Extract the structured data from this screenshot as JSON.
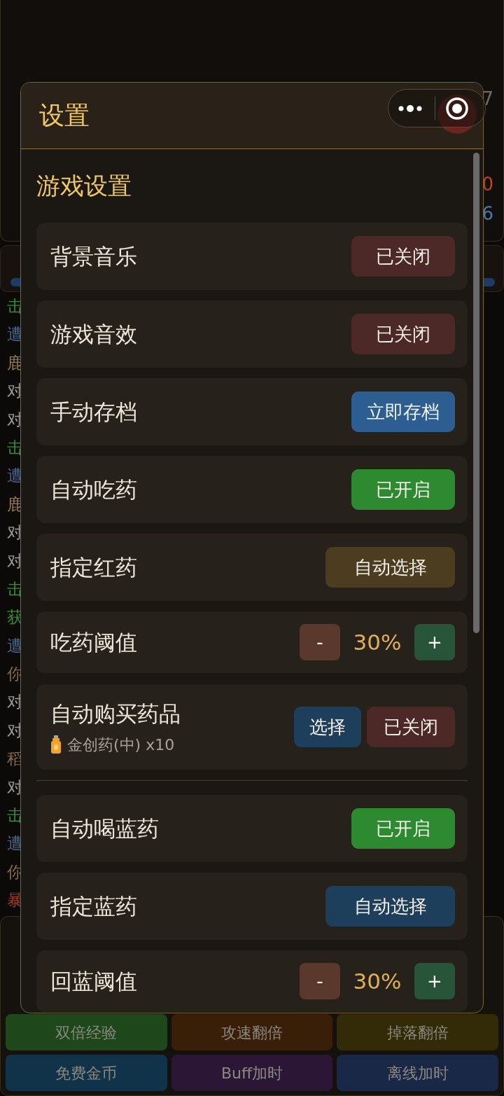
{
  "background": {
    "corner_mark": "7",
    "stats": [
      {
        "value": "0",
        "color": "#b8452e"
      },
      {
        "value": "6",
        "color": "#4a78b8"
      }
    ],
    "log": [
      {
        "text": "击",
        "color": "#3e8a3a"
      },
      {
        "text": "遭",
        "color": "#4a6890"
      },
      {
        "text": "鹿",
        "color": "#9a7a4a"
      },
      {
        "text": "对",
        "color": "#9a9a9a"
      },
      {
        "text": "对",
        "color": "#9a9a9a"
      },
      {
        "text": "击",
        "color": "#3e8a3a"
      },
      {
        "text": "遭",
        "color": "#4a6890"
      },
      {
        "text": "鹿",
        "color": "#9a7a4a"
      },
      {
        "text": "对",
        "color": "#9a9a9a"
      },
      {
        "text": "对",
        "color": "#9a9a9a"
      },
      {
        "text": "击",
        "color": "#3e8a3a"
      },
      {
        "text": "获",
        "color": "#3e8a3a"
      },
      {
        "text": "遭",
        "color": "#4a6890"
      },
      {
        "text": "你",
        "color": "#8a6a40"
      },
      {
        "text": "对",
        "color": "#9a9a9a"
      },
      {
        "text": "对",
        "color": "#9a9a9a"
      },
      {
        "text": "稻",
        "color": "#8a6a40"
      },
      {
        "text": "对",
        "color": "#9a9a9a"
      },
      {
        "text": "击",
        "color": "#3e8a3a"
      },
      {
        "text": "遭",
        "color": "#4a6890"
      },
      {
        "text": "你",
        "color": "#8a6a40"
      },
      {
        "text": "暴",
        "color": "#a83a28"
      }
    ],
    "boost_buttons": [
      {
        "label": "双倍经验",
        "color": "#1e481c"
      },
      {
        "label": "攻速翻倍",
        "color": "#3a1f08"
      },
      {
        "label": "掉落翻倍",
        "color": "#332a08"
      },
      {
        "label": "免费金币",
        "color": "#11334a"
      },
      {
        "label": "Buff加时",
        "color": "#2c1636"
      },
      {
        "label": "离线加时",
        "color": "#182846"
      }
    ]
  },
  "modal": {
    "title": "设置",
    "section": "游戏设置",
    "rows": [
      {
        "kind": "toggle",
        "label": "背景音乐",
        "button": {
          "label": "已关闭",
          "on": false
        }
      },
      {
        "kind": "toggle",
        "label": "游戏音效",
        "button": {
          "label": "已关闭",
          "on": false
        }
      },
      {
        "kind": "action",
        "label": "手动存档",
        "button": {
          "label": "立即存档"
        }
      },
      {
        "kind": "toggle",
        "label": "自动吃药",
        "button": {
          "label": "已开启",
          "on": true
        }
      },
      {
        "kind": "redpicker",
        "label": "指定红药",
        "button": {
          "label": "自动选择"
        }
      },
      {
        "kind": "stepper",
        "label": "吃药阈值",
        "minus": "-",
        "value": "30%",
        "plus": "+"
      },
      {
        "kind": "purchase",
        "label": "自动购买药品",
        "item": "金创药(中) x10",
        "choose": "选择",
        "button": {
          "label": "已关闭",
          "on": false
        }
      },
      {
        "kind": "toggle",
        "label": "自动喝蓝药",
        "button": {
          "label": "已开启",
          "on": true
        }
      },
      {
        "kind": "bluepicker",
        "label": "指定蓝药",
        "button": {
          "label": "自动选择"
        }
      },
      {
        "kind": "stepper",
        "label": "回蓝阈值",
        "minus": "-",
        "value": "30%",
        "plus": "+"
      }
    ]
  }
}
